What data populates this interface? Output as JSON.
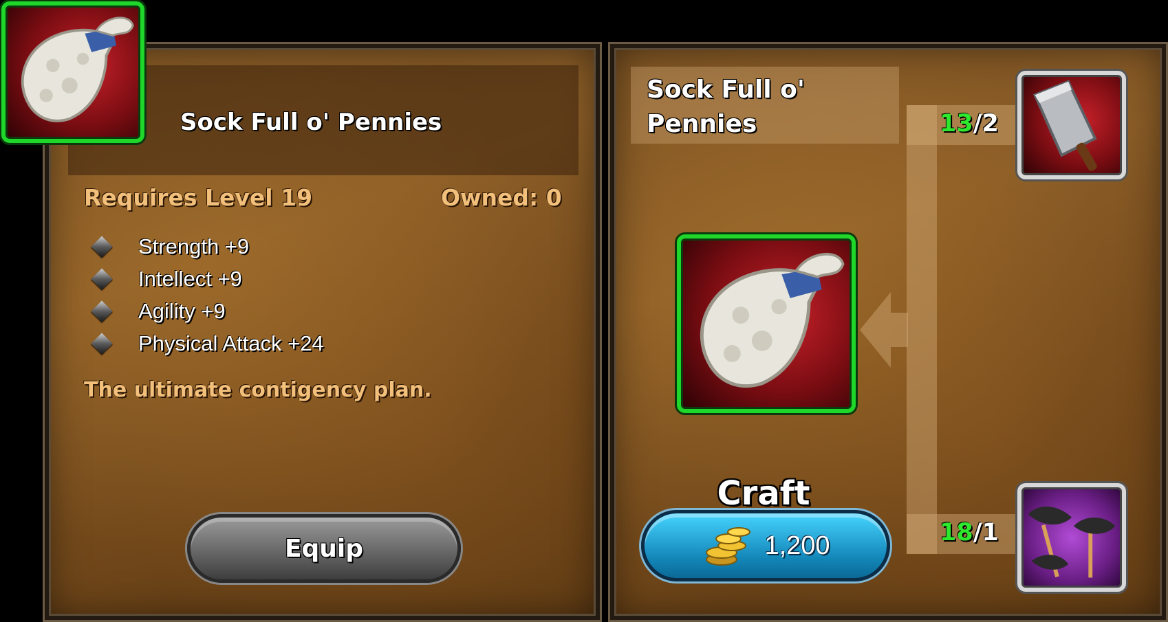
{
  "item": {
    "name": "Sock Full o' Pennies",
    "requires": "Requires Level 19",
    "owned": "Owned: 0",
    "stats": [
      "Strength +9",
      "Intellect +9",
      "Agility +9",
      "Physical Attack +24"
    ],
    "flavor": "The ultimate contigency plan.",
    "icon": "sock-full-of-pennies-icon"
  },
  "actions": {
    "equip_label": "Equip"
  },
  "recipe": {
    "name_line1": "Sock Full o'",
    "name_line2": "Pennies",
    "craft_label": "Craft",
    "craft_cost": "1,200",
    "cost_icon": "gold-coins-icon",
    "ingredients": [
      {
        "icon": "cleaver-icon",
        "have": "13",
        "need": "/2"
      },
      {
        "icon": "fake-mustache-icon",
        "have": "18",
        "need": "/1"
      }
    ]
  }
}
